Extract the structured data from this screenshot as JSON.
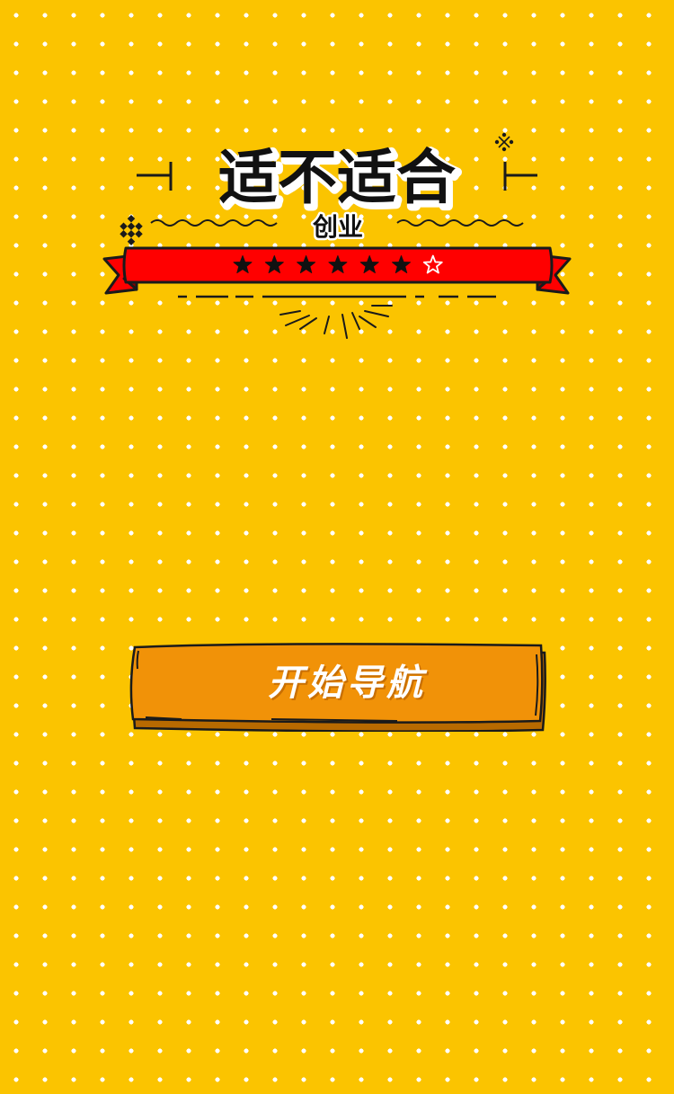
{
  "title": {
    "main": "适不适合",
    "sub": "创业"
  },
  "rating": {
    "filled_stars": 6,
    "total_stars": 7
  },
  "button": {
    "label": "开始导航"
  },
  "colors": {
    "background": "#fbc400",
    "dots": "#ffffff",
    "ribbon": "#ff0000",
    "button": "#f19208",
    "outline": "#1a1a1a"
  }
}
